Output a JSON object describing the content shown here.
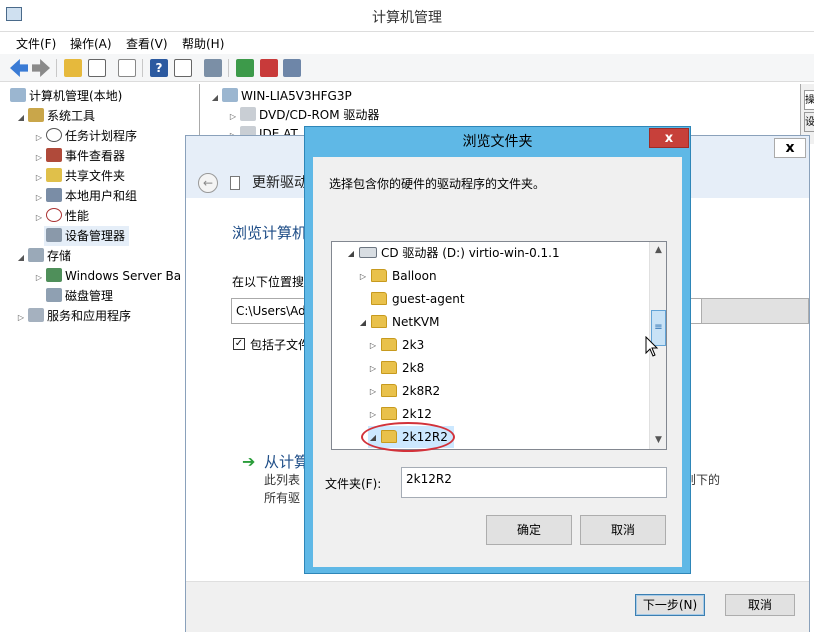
{
  "main_window": {
    "title": "计算机管理",
    "menu": [
      "文件(F)",
      "操作(A)",
      "查看(V)",
      "帮助(H)"
    ],
    "left_tree": [
      {
        "label": "计算机管理(本地)",
        "toggle": ""
      },
      {
        "label": "系统工具",
        "toggle": "◢"
      },
      {
        "label": "任务计划程序",
        "toggle": "▷"
      },
      {
        "label": "事件查看器",
        "toggle": "▷"
      },
      {
        "label": "共享文件夹",
        "toggle": "▷"
      },
      {
        "label": "本地用户和组",
        "toggle": "▷"
      },
      {
        "label": "性能",
        "toggle": "▷"
      },
      {
        "label": "设备管理器",
        "toggle": ""
      },
      {
        "label": "存储",
        "toggle": "◢"
      },
      {
        "label": "Windows Server Ba",
        "toggle": "▷"
      },
      {
        "label": "磁盘管理",
        "toggle": ""
      },
      {
        "label": "服务和应用程序",
        "toggle": "▷"
      }
    ],
    "device_tree": [
      {
        "label": "WIN-LIA5V3HFG3P",
        "toggle": "◢"
      },
      {
        "label": "DVD/CD-ROM 驱动器",
        "toggle": "▷"
      },
      {
        "label": "IDE AT",
        "toggle": "▷"
      }
    ],
    "right_panel": {
      "tab1": "操",
      "tab2": "设"
    }
  },
  "wizard": {
    "heading": "更新驱动",
    "body_title": "浏览计算机",
    "search_label": "在以下位置搜",
    "path_value": "C:\\Users\\Ad",
    "include_subfolders": "包括子文件",
    "pick_title": "从计算",
    "desc_line1": "此列表",
    "desc_line2": "所有驱",
    "desc_right": "则下的",
    "next_button": "下一步(N)",
    "cancel_button": "取消",
    "close_glyph": "x"
  },
  "browse_dialog": {
    "title": "浏览文件夹",
    "close_glyph": "x",
    "message": "选择包含你的硬件的驱动程序的文件夹。",
    "tree": [
      {
        "label": "CD 驱动器 (D:) virtio-win-0.1.1",
        "toggle": "◢",
        "icon": "drive-icon",
        "level": 0
      },
      {
        "label": "Balloon",
        "toggle": "▷",
        "icon": "folder-icon",
        "level": 1
      },
      {
        "label": "guest-agent",
        "toggle": "",
        "icon": "folder-icon",
        "level": 1
      },
      {
        "label": "NetKVM",
        "toggle": "◢",
        "icon": "folder-icon",
        "level": 1
      },
      {
        "label": "2k3",
        "toggle": "▷",
        "icon": "folder-icon",
        "level": 2
      },
      {
        "label": "2k8",
        "toggle": "▷",
        "icon": "folder-icon",
        "level": 2
      },
      {
        "label": "2k8R2",
        "toggle": "▷",
        "icon": "folder-icon",
        "level": 2
      },
      {
        "label": "2k12",
        "toggle": "▷",
        "icon": "folder-icon",
        "level": 2
      },
      {
        "label": "2k12R2",
        "toggle": "◢",
        "icon": "folder-icon",
        "level": 2
      }
    ],
    "folder_label": "文件夹(F):",
    "folder_value": "2k12R2",
    "ok_button": "确定",
    "cancel_button": "取消",
    "scroll_up": "▲",
    "scroll_down": "▼",
    "scroll_grip": "≡"
  },
  "colors": {
    "dialog_frame": "#5fb8e6",
    "close_red": "#c7403a",
    "highlight_ring": "#d2323a",
    "wizard_title_blue": "#1e4d87",
    "green_arrow": "#2a9d3a"
  }
}
